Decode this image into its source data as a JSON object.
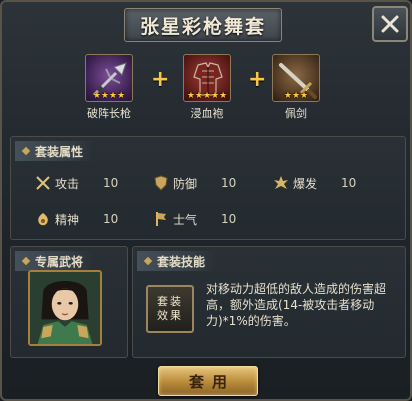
{
  "title": "张星彩枪舞套",
  "items": [
    {
      "name": "破阵长枪",
      "stars": "★★★★",
      "icon": "spear-icon",
      "rarity_color": "#7d4e98"
    },
    {
      "name": "浸血袍",
      "stars": "★★★★★",
      "icon": "armor-robe-icon",
      "rarity_color": "#a43d35"
    },
    {
      "name": "佩剑",
      "stars": "★★★",
      "icon": "sword-icon",
      "rarity_color": "#8a6a44"
    }
  ],
  "set_attributes": {
    "header": "套装属性",
    "attrs": [
      {
        "name": "攻击",
        "value": "10",
        "icon": "attack-crossed-swords-icon"
      },
      {
        "name": "防御",
        "value": "10",
        "icon": "defense-shield-icon"
      },
      {
        "name": "爆发",
        "value": "10",
        "icon": "burst-icon"
      },
      {
        "name": "精神",
        "value": "10",
        "icon": "spirit-icon"
      },
      {
        "name": "士气",
        "value": "10",
        "icon": "morale-banner-icon"
      }
    ]
  },
  "exclusive_general": {
    "header": "专属武将",
    "portrait_icon": "general-portrait"
  },
  "set_skill": {
    "header": "套装技能",
    "icon_label_line1": "套装",
    "icon_label_line2": "效果",
    "description": "对移动力超低的敌人造成的伤害超高，额外造成(14-被攻击者移动力)*1%的伤害。"
  },
  "apply_button": "套用",
  "colors": {
    "accent_gold": "#f5c74a",
    "star": "#ffcb3c"
  }
}
